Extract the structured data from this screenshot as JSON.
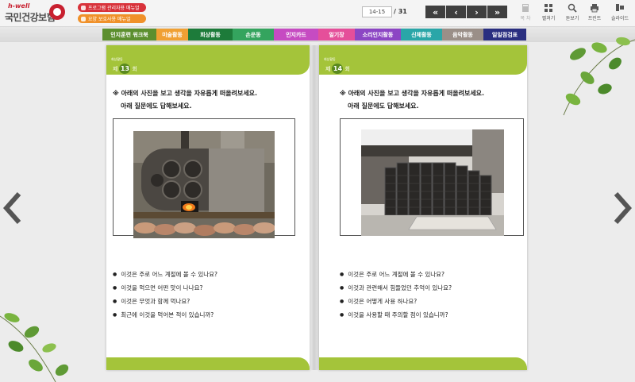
{
  "header": {
    "logo_small": "h-well",
    "logo_main": "국민건강보험",
    "manual_buttons": [
      {
        "label": "프로그램 관리자용 매뉴얼",
        "color": "#d8323a"
      },
      {
        "label": "요양 보호사용 매뉴얼",
        "color": "#f0912a"
      }
    ],
    "page_input_value": "14-15",
    "page_total": "/ 31",
    "nav": {
      "first": "«",
      "prev": "‹",
      "next": "›",
      "last": "»"
    },
    "tools": [
      {
        "label": "목 차",
        "icon": "book-icon",
        "enabled": false
      },
      {
        "label": "펼쳐기",
        "icon": "grid-icon",
        "enabled": true
      },
      {
        "label": "돋보기",
        "icon": "magnifier-icon",
        "enabled": true
      },
      {
        "label": "프린트",
        "icon": "printer-icon",
        "enabled": true
      },
      {
        "label": "슬라이드",
        "icon": "slide-icon",
        "enabled": true
      }
    ]
  },
  "menu": [
    {
      "label": "인지훈련 워크북",
      "color": "#5c8f2e",
      "width": 68
    },
    {
      "label": "미술활동",
      "color": "#f0a033",
      "width": 40
    },
    {
      "label": "회상활동",
      "color": "#1d7b3a",
      "width": 56
    },
    {
      "label": "손운동",
      "color": "#34a45e",
      "width": 52
    },
    {
      "label": "인지카드",
      "color": "#c64bc2",
      "width": 56
    },
    {
      "label": "일기장",
      "color": "#e54f9a",
      "width": 46
    },
    {
      "label": "소리인지활동",
      "color": "#8c46c4",
      "width": 58
    },
    {
      "label": "신체활동",
      "color": "#2aa6a8",
      "width": 52
    },
    {
      "label": "음악활동",
      "color": "#9a8f88",
      "width": 52
    },
    {
      "label": "일일점검표",
      "color": "#2a2f80",
      "width": 54
    }
  ],
  "pages": [
    {
      "section": "회상활동",
      "round_prefix": "제",
      "round_number": "13",
      "round_suffix": "회",
      "instruction_line1": "※ 아래의 사진을 보고 생각을 자유롭게 떠올려보세요.",
      "instruction_line2": "아래 질문에도 답해보세요.",
      "questions": [
        "이것은 주로 어느 계절에 볼 수 있나요?",
        "이것을 먹으면 어떤 맛이 나나요?",
        "이것은 무엇과 함께 먹나요?",
        "최근에 이것을 먹어본 적이 있습니까?"
      ]
    },
    {
      "section": "회상활동",
      "round_prefix": "제",
      "round_number": "14",
      "round_suffix": "회",
      "instruction_line1": "※ 아래의 사진을 보고 생각을 자유롭게 떠올려보세요.",
      "instruction_line2": "아래 질문에도 답해보세요.",
      "questions": [
        "이것은 주로 어느 계절에 볼 수 있나요?",
        "이것과 관련해서 힘들었던 추억이 있나요?",
        "이것은 어떻게 사용 하나요?",
        "이것을 사용할 때 주의할 점이 있습니까?"
      ]
    }
  ]
}
